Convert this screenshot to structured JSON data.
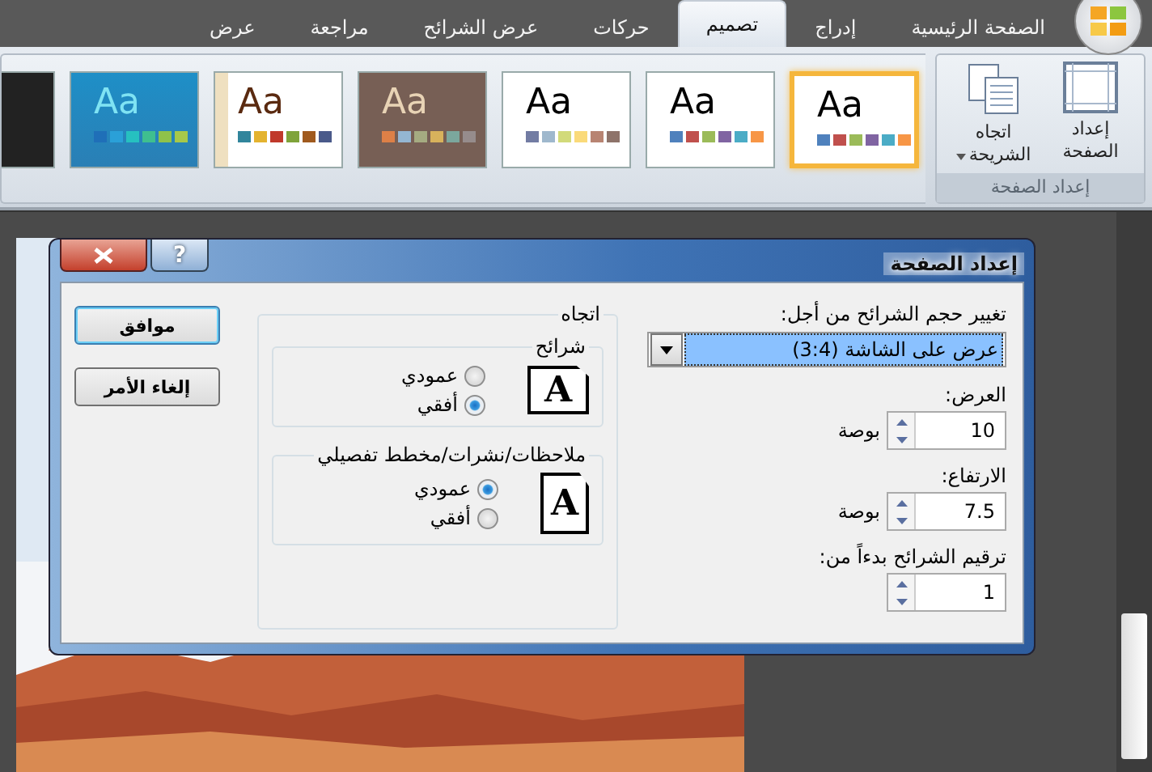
{
  "tabs": [
    {
      "label": "الصفحة الرئيسية",
      "selected": false
    },
    {
      "label": "إدراج",
      "selected": false
    },
    {
      "label": "تصميم",
      "selected": true
    },
    {
      "label": "حركات",
      "selected": false
    },
    {
      "label": "عرض الشرائح",
      "selected": false
    },
    {
      "label": "مراجعة",
      "selected": false
    },
    {
      "label": "عرض",
      "selected": false
    }
  ],
  "ribbon": {
    "page_setup": {
      "label": "إعداد الصفحة",
      "buttons": [
        {
          "label": "إعداد الصفحة",
          "kind": "page"
        },
        {
          "label": "اتجاه الشريحة",
          "kind": "orientation"
        }
      ]
    },
    "themes": [
      {
        "label": "Aa",
        "selected": true
      },
      {
        "label": "Aa",
        "selected": false
      },
      {
        "label": "Aa",
        "selected": false
      },
      {
        "label": "Aa",
        "selected": false
      },
      {
        "label": "Aa",
        "selected": false
      },
      {
        "label": "Aa",
        "selected": false
      }
    ]
  },
  "dialog": {
    "title": "إعداد الصفحة",
    "help": "?",
    "size_for": {
      "label": "تغيير حجم الشرائح من أجل:",
      "value": "عرض على الشاشة (3:4)"
    },
    "fields": [
      {
        "label": "العرض:",
        "value": "10",
        "unit": "بوصة"
      },
      {
        "label": "الارتفاع:",
        "value": "7.5",
        "unit": "بوصة"
      },
      {
        "label": "ترقيم الشرائح بدءاً من:",
        "value": "1"
      }
    ],
    "orientation": {
      "label": "اتجاه",
      "groups": [
        {
          "label": "شرائح",
          "letter": "A",
          "options": [
            {
              "label": "عمودي",
              "selected": false
            },
            {
              "label": "أفقي",
              "selected": true
            }
          ]
        },
        {
          "label": "ملاحظات/نشرات/مخطط تفصيلي",
          "letter": "A",
          "options": [
            {
              "label": "عمودي",
              "selected": true
            },
            {
              "label": "أفقي",
              "selected": false
            }
          ]
        }
      ]
    },
    "buttons": [
      {
        "label": "موافق",
        "kind": "default"
      },
      {
        "label": "إلغاء الأمر",
        "kind": "normal"
      }
    ]
  }
}
